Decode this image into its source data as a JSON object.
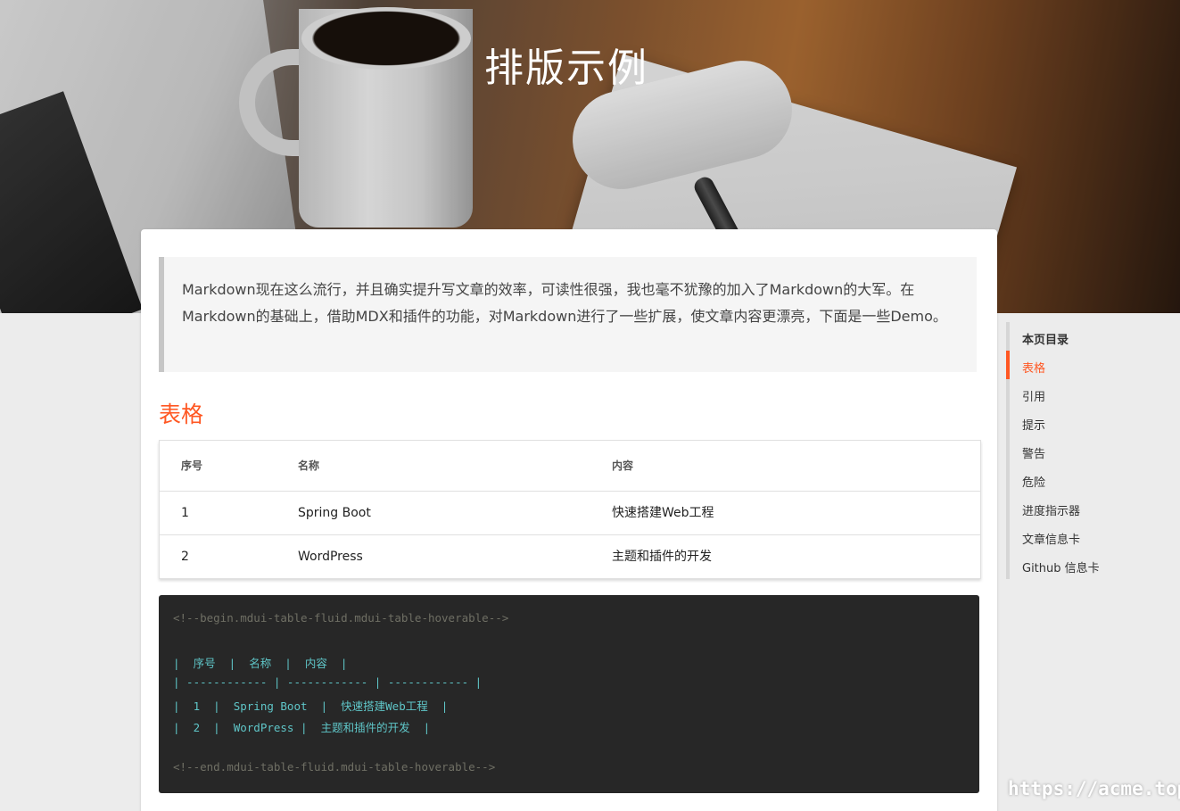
{
  "hero": {
    "title": "排版示例"
  },
  "intro": {
    "text": "Markdown现在这么流行，并且确实提升写文章的效率，可读性很强，我也毫不犹豫的加入了Markdown的大军。在Markdown的基础上，借助MDX和插件的功能，对Markdown进行了一些扩展，使文章内容更漂亮，下面是一些Demo。"
  },
  "section": {
    "title": "表格"
  },
  "table": {
    "headers": [
      "序号",
      "名称",
      "内容"
    ],
    "rows": [
      [
        "1",
        "Spring Boot",
        "快速搭建Web工程"
      ],
      [
        "2",
        "WordPress",
        "主题和插件的开发"
      ]
    ]
  },
  "code": {
    "lines": [
      "<!--begin.mdui-table-fluid.mdui-table-hoverable-->",
      "",
      "|  序号  |  名称  |  内容  |",
      "| ------------ | ------------ | ------------ |",
      "|  1  |  Spring Boot  |  快速搭建Web工程  |",
      "|  2  |  WordPress |  主题和插件的开发  |",
      "",
      "<!--end.mdui-table-fluid.mdui-table-hoverable-->"
    ]
  },
  "toc": {
    "title": "本页目录",
    "items": [
      "表格",
      "引用",
      "提示",
      "警告",
      "危险",
      "进度指示器",
      "文章信息卡",
      "Github 信息卡"
    ],
    "active_index": 0,
    "accent": "#ff5722"
  },
  "watermark": {
    "text": "https://acme.top"
  }
}
